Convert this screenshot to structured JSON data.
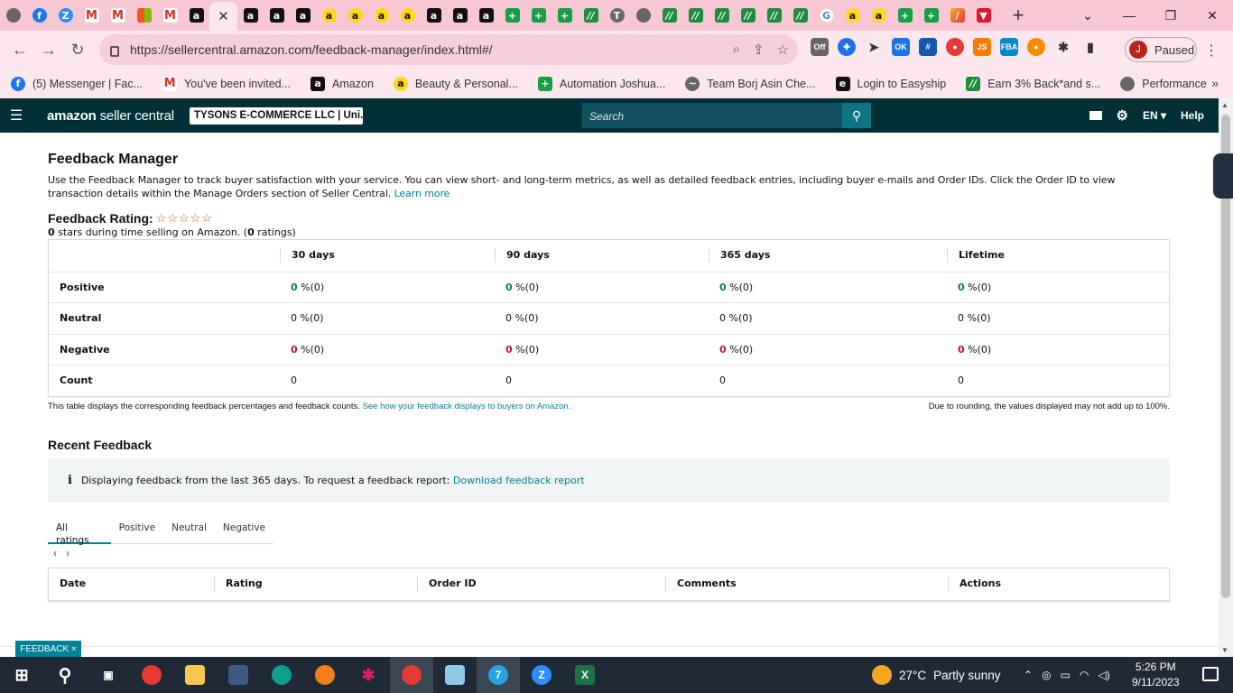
{
  "browser": {
    "tabs": [
      {
        "icon": "chrome-icon",
        "glyph": "",
        "kind": "chrome"
      },
      {
        "icon": "facebook-icon",
        "glyph": "f",
        "kind": "fb"
      },
      {
        "icon": "zoom-icon",
        "glyph": "Z",
        "kind": "zoom"
      },
      {
        "icon": "gmail-icon",
        "glyph": "M",
        "kind": "gm"
      },
      {
        "icon": "gmail-icon",
        "glyph": "M",
        "kind": "gm"
      },
      {
        "icon": "microsoft-icon",
        "glyph": "",
        "kind": "ms"
      },
      {
        "icon": "gmail-icon",
        "glyph": "M",
        "kind": "gm"
      },
      {
        "icon": "amazon-icon",
        "glyph": "a",
        "kind": "amz"
      },
      {
        "icon": "amazon-icon",
        "glyph": "a",
        "kind": "amz"
      },
      {
        "icon": "amazon-icon",
        "glyph": "a",
        "kind": "amz"
      },
      {
        "icon": "amazon-icon",
        "glyph": "a",
        "kind": "amz"
      },
      {
        "icon": "amazon-smile-icon",
        "glyph": "a",
        "kind": "amzy"
      },
      {
        "icon": "amazon-smile-icon",
        "glyph": "a",
        "kind": "amzy"
      },
      {
        "icon": "amazon-smile-icon",
        "glyph": "a",
        "kind": "amzy"
      },
      {
        "icon": "amazon-smile-icon",
        "glyph": "a",
        "kind": "amzy"
      },
      {
        "icon": "amazon-icon",
        "glyph": "a",
        "kind": "amz"
      },
      {
        "icon": "amazon-icon",
        "glyph": "a",
        "kind": "amz"
      },
      {
        "icon": "amazon-icon",
        "glyph": "a",
        "kind": "amz"
      },
      {
        "icon": "sheets-plus-icon",
        "glyph": "+",
        "kind": "green"
      },
      {
        "icon": "sheets-plus-icon",
        "glyph": "+",
        "kind": "green"
      },
      {
        "icon": "sheets-plus-icon",
        "glyph": "+",
        "kind": "green"
      },
      {
        "icon": "zz-icon",
        "glyph": "//",
        "kind": "zz"
      },
      {
        "icon": "tg-icon",
        "glyph": "T",
        "kind": "chrome"
      },
      {
        "icon": "globe-icon",
        "glyph": "",
        "kind": "chrome"
      },
      {
        "icon": "zz-icon",
        "glyph": "//",
        "kind": "zz"
      },
      {
        "icon": "zz-icon",
        "glyph": "//",
        "kind": "zz"
      },
      {
        "icon": "zz-icon",
        "glyph": "//",
        "kind": "zz"
      },
      {
        "icon": "zz-icon",
        "glyph": "//",
        "kind": "zz"
      },
      {
        "icon": "zz-icon",
        "glyph": "//",
        "kind": "zz"
      },
      {
        "icon": "zz-icon",
        "glyph": "//",
        "kind": "zz"
      },
      {
        "icon": "google-icon",
        "glyph": "G",
        "kind": "goog"
      },
      {
        "icon": "amazon-smile-icon",
        "glyph": "a",
        "kind": "amzy"
      },
      {
        "icon": "amazon-smile-icon",
        "glyph": "a",
        "kind": "amzy"
      },
      {
        "icon": "sheets-plus-icon",
        "glyph": "+",
        "kind": "green"
      },
      {
        "icon": "sheets-plus-icon",
        "glyph": "+",
        "kind": "green"
      },
      {
        "icon": "pen-icon",
        "glyph": "/",
        "kind": "multi"
      },
      {
        "icon": "shield-icon",
        "glyph": "▼",
        "kind": "red"
      }
    ],
    "active_tab_after": 7,
    "url": "https://sellercentral.amazon.com/feedback-manager/index.html#/",
    "profile_initial": "J",
    "profile_status": "Paused",
    "bookmarks": [
      {
        "icon": "facebook-icon",
        "glyph": "f",
        "kind": "fb",
        "label": "(5) Messenger | Fac..."
      },
      {
        "icon": "gmail-icon",
        "glyph": "M",
        "kind": "gm",
        "label": "You've been invited..."
      },
      {
        "icon": "amazon-icon",
        "glyph": "a",
        "kind": "amz",
        "label": "Amazon"
      },
      {
        "icon": "amazon-smile-icon",
        "glyph": "a",
        "kind": "amzy",
        "label": "Beauty & Personal..."
      },
      {
        "icon": "sheets-plus-icon",
        "glyph": "+",
        "kind": "green",
        "label": "Automation Joshua..."
      },
      {
        "icon": "borj-icon",
        "glyph": "~",
        "kind": "chrome",
        "label": "Team Borj Asin Che..."
      },
      {
        "icon": "easyship-icon",
        "glyph": "e",
        "kind": "amz",
        "label": "Login to Easyship"
      },
      {
        "icon": "zz-icon",
        "glyph": "//",
        "kind": "zz",
        "label": "Earn 3% Back*and s..."
      },
      {
        "icon": "performance-icon",
        "glyph": "",
        "kind": "chrome",
        "label": "Performance"
      }
    ]
  },
  "header": {
    "logo_brand": "amazon",
    "logo_product": " seller central",
    "store": "TYSONS E-COMMERCE LLC | Uni...",
    "search_placeholder": "Search",
    "language": "EN",
    "help": "Help"
  },
  "page": {
    "title": "Feedback Manager",
    "description": "Use the Feedback Manager to track buyer satisfaction with your service. You can view short- and long-term metrics, as well as detailed feedback entries, including buyer e-mails and Order IDs. Click the Order ID to view transaction details within the Manage Orders section of Seller Central.",
    "learn_more": "Learn more",
    "rating_label": "Feedback Rating:",
    "stars": "☆☆☆☆☆",
    "rating_stars_value": "0",
    "rating_sub_mid": " stars during time selling on Amazon. (",
    "rating_count": "0",
    "rating_sub_end": " ratings)"
  },
  "feedback_table": {
    "columns": [
      "",
      "30 days",
      "90 days",
      "365 days",
      "Lifetime"
    ],
    "rows": [
      {
        "label": "Positive",
        "style": "g",
        "cells": [
          [
            "0",
            " %(0)"
          ],
          [
            "0",
            " %(0)"
          ],
          [
            "0",
            " %(0)"
          ],
          [
            "0",
            " %(0)"
          ]
        ]
      },
      {
        "label": "Neutral",
        "style": "n",
        "cells": [
          [
            "0",
            " %(0)"
          ],
          [
            "0",
            " %(0)"
          ],
          [
            "0",
            " %(0)"
          ],
          [
            "0",
            " %(0)"
          ]
        ]
      },
      {
        "label": "Negative",
        "style": "r",
        "cells": [
          [
            "0",
            " %(0)"
          ],
          [
            "0",
            " %(0)"
          ],
          [
            "0",
            " %(0)"
          ],
          [
            "0",
            " %(0)"
          ]
        ]
      },
      {
        "label": "Count",
        "style": "n",
        "cells": [
          [
            "0",
            ""
          ],
          [
            "0",
            ""
          ],
          [
            "0",
            ""
          ],
          [
            "0",
            ""
          ]
        ]
      }
    ],
    "note_left": "This table displays the corresponding feedback percentages and feedback counts.",
    "note_link": "See how your feedback displays to buyers on Amazon.",
    "note_right": "Due to rounding, the values displayed may not add up to 100%."
  },
  "recent": {
    "title": "Recent Feedback",
    "info_icon": "i",
    "info_text": "Displaying feedback from the last 365 days. To request a feedback report:",
    "info_link": "Download feedback report",
    "tabs": [
      "All ratings",
      "Positive",
      "Neutral",
      "Negative"
    ],
    "selected_tab": "All ratings",
    "pager_prev": "‹",
    "pager_next": "›",
    "columns": [
      "Date",
      "Rating",
      "Order ID",
      "Comments",
      "Actions"
    ]
  },
  "feedback_button": "FEEDBACK ×",
  "taskbar": {
    "temperature": "27°C",
    "weather": "Partly sunny",
    "time": "5:26 PM",
    "date": "9/11/2023",
    "telegram_badge": "7"
  },
  "colors": {
    "positive": "#067d62",
    "negative": "#cc0c39",
    "link": "#008296",
    "header_bg": "#002f36"
  }
}
